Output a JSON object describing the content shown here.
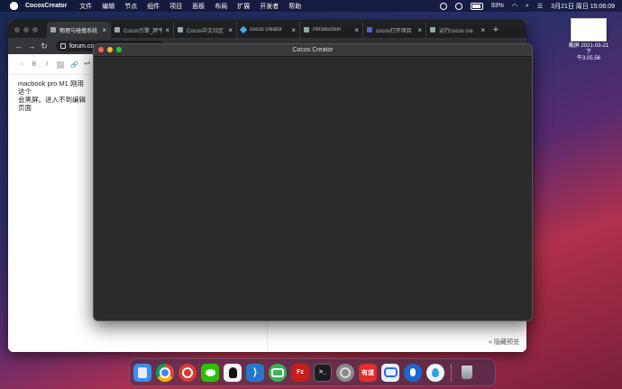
{
  "menubar": {
    "app_name": "CocosCreator",
    "items": [
      "文件",
      "编辑",
      "节点",
      "组件",
      "项目",
      "面板",
      "布局",
      "扩展",
      "开发者",
      "帮助"
    ],
    "battery_percent": "93%",
    "datetime": "3月21日 周日  15:06:09"
  },
  "desktop": {
    "file_label_line1": "截屏 2021-03-21 下",
    "file_label_line2": "午3.05.56"
  },
  "browser": {
    "tabs": [
      {
        "title": "物理与碰撞系统",
        "icon": "cocos-doc-icon",
        "active": true
      },
      {
        "title": "Cocos引擎_跨平台",
        "icon": "cocos-icon",
        "active": false
      },
      {
        "title": "Cocos中文社区",
        "icon": "cocos-icon",
        "active": false
      },
      {
        "title": "cocos creator",
        "icon": "diamond-icon",
        "active": false
      },
      {
        "title": "Introduction",
        "icon": "page-icon",
        "active": false
      },
      {
        "title": "cocos打开项目",
        "icon": "baidu-icon",
        "active": false
      },
      {
        "title": "运行cocos cre",
        "icon": "cocos-icon",
        "active": false
      }
    ],
    "url": "forum.co",
    "toolbar": [
      "○",
      "B",
      "I",
      "|",
      "🔗",
      "❝❞",
      "⟨⟩"
    ],
    "post_text_line1": "macbook pro M1 刚用这个",
    "post_text_line2": "会黑屏。进入不到编辑页面",
    "hide_preview": "« 隐藏预览"
  },
  "cocos_window": {
    "title": "Cocos Creator"
  },
  "dock": {
    "apps": [
      {
        "name": "finder",
        "label": "",
        "color": "#3d8ef0"
      },
      {
        "name": "chrome",
        "label": "",
        "color": "#e8e8e8"
      },
      {
        "name": "netease-music",
        "label": "",
        "color": "#d83a34"
      },
      {
        "name": "wechat",
        "label": "",
        "color": "#2dc100"
      },
      {
        "name": "qq",
        "label": "",
        "color": "#f2f2f2"
      },
      {
        "name": "vscode",
        "label": "",
        "color": "#2478cc"
      },
      {
        "name": "wechat-devtools",
        "label": "",
        "color": "#3ab35a"
      },
      {
        "name": "filezilla",
        "label": "Fz",
        "color": "#c41e1e"
      },
      {
        "name": "terminal",
        "label": ">_",
        "color": "#1d1d1d"
      },
      {
        "name": "system-preferences",
        "label": "",
        "color": "#8a8a8a"
      },
      {
        "name": "youdao",
        "label": "有道",
        "color": "#e02d2d"
      },
      {
        "name": "baidu-netdisk",
        "label": "",
        "color": "#eaf1ff"
      },
      {
        "name": "tunnel-app",
        "label": "",
        "color": "#1e66d0"
      },
      {
        "name": "cocos-drop",
        "label": "",
        "color": "#f0f4f8"
      },
      {
        "name": "trash",
        "label": "",
        "color": "#9aa0a6"
      }
    ]
  }
}
